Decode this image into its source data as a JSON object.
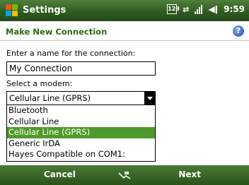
{
  "titlebar": {
    "app_title": "Settings",
    "time": "9:59",
    "icons": [
      "windows-start-icon",
      "input-panel-icon",
      "connectivity-arrows-icon",
      "signal-icon",
      "speaker-icon"
    ],
    "input_icon_text": "123",
    "colors": {
      "bar": "#2d5a1e",
      "text": "#ffffff"
    }
  },
  "header": {
    "title": "Make New Connection",
    "help_icon": "help-icon",
    "help_glyph": "?",
    "title_color": "#2d6b12"
  },
  "form": {
    "name_label": "Enter a name for the connection:",
    "name_value": "My Connection",
    "modem_label": "Select a modem:",
    "modem_selected": "Cellular Line (GPRS)",
    "modem_options": [
      {
        "label": "Bluetooth",
        "selected": false
      },
      {
        "label": "Cellular Line",
        "selected": false
      },
      {
        "label": "Cellular Line (GPRS)",
        "selected": true
      },
      {
        "label": "Generic IrDA",
        "selected": false
      },
      {
        "label": "Hayes Compatible on COM1:",
        "selected": false
      }
    ],
    "highlight_color": "#4e9a2a"
  },
  "softkeys": {
    "left": "Cancel",
    "right": "Next",
    "center_icon": "keyboard-icon"
  }
}
